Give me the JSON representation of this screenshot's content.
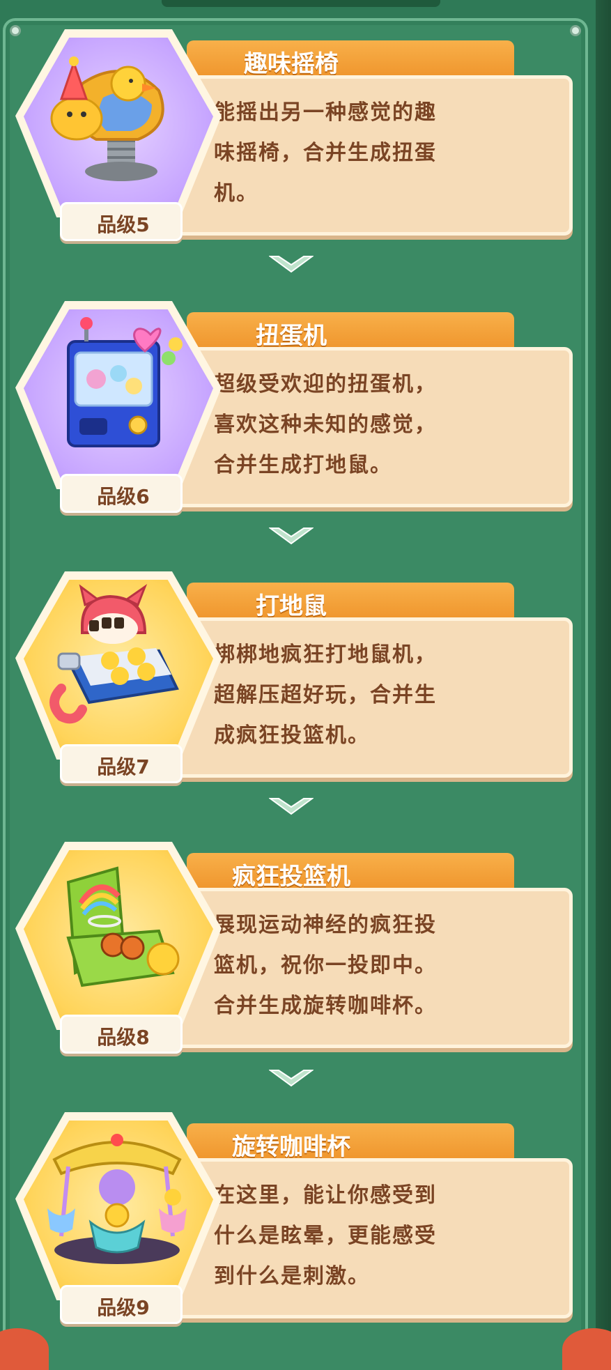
{
  "items": [
    {
      "title": "趣味摇椅",
      "desc_lines": [
        "能摇出另一种感觉的趣",
        "味摇椅，合并生成扭蛋",
        "机。"
      ],
      "grade": "品级5",
      "icon": "rocking-chair-icon",
      "bg": "purple"
    },
    {
      "title": "扭蛋机",
      "desc_lines": [
        "超级受欢迎的扭蛋机，",
        "喜欢这种未知的感觉，",
        "合并生成打地鼠。"
      ],
      "grade": "品级6",
      "icon": "gashapon-machine-icon",
      "bg": "purple"
    },
    {
      "title": "打地鼠",
      "desc_lines": [
        "梆梆地疯狂打地鼠机，",
        "超解压超好玩，合并生",
        "成疯狂投篮机。"
      ],
      "grade": "品级7",
      "icon": "whack-a-mole-icon",
      "bg": "yellow"
    },
    {
      "title": "疯狂投篮机",
      "desc_lines": [
        "展现运动神经的疯狂投",
        "篮机，祝你一投即中。",
        "合并生成旋转咖啡杯。"
      ],
      "grade": "品级8",
      "icon": "basketball-machine-icon",
      "bg": "yellow"
    },
    {
      "title": "旋转咖啡杯",
      "desc_lines": [
        "在这里，能让你感受到",
        "什么是眩晕，更能感受",
        "到什么是刺激。"
      ],
      "grade": "品级9",
      "icon": "teacup-ride-icon",
      "bg": "yellow"
    }
  ],
  "colors": {
    "board": "#3b8a64",
    "title_tab": "#f2a03a",
    "card": "#f6dcb8",
    "text": "#7a4424"
  }
}
